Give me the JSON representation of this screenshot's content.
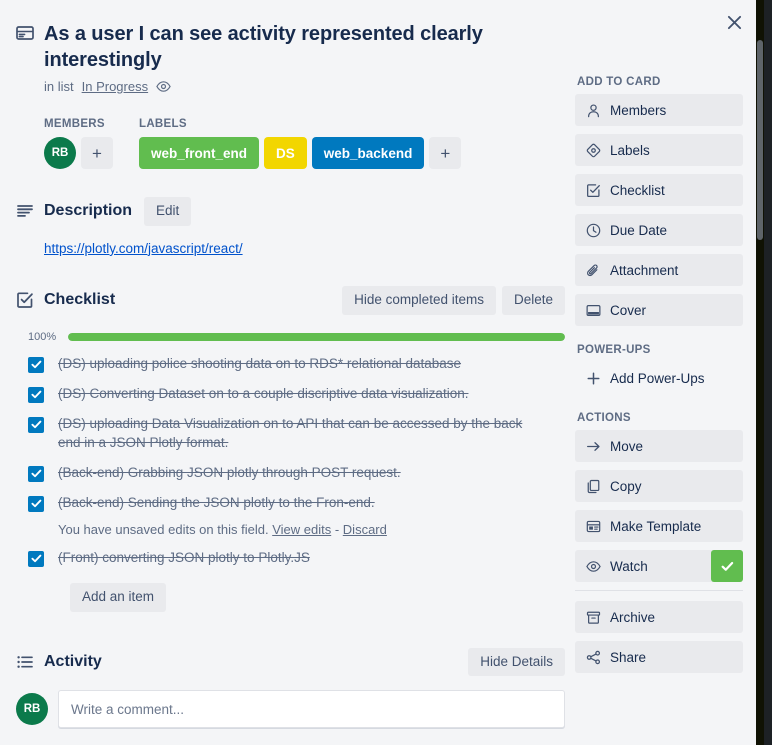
{
  "window": {
    "close_label": "×"
  },
  "card": {
    "icon": "card-window-icon",
    "title": "As a user I can see activity represented clearly interestingly",
    "in_list_prefix": "in list",
    "list_name": "In Progress",
    "watching_icon": "eye-icon"
  },
  "members": {
    "heading": "MEMBERS",
    "avatars": [
      {
        "initials": "RB",
        "color": "#0b7a4b"
      }
    ],
    "add_label": "+"
  },
  "labels": {
    "heading": "LABELS",
    "chips": [
      {
        "text": "web_front_end",
        "color": "#61bd4f"
      },
      {
        "text": "DS",
        "color": "#f2d600"
      },
      {
        "text": "web_backend",
        "color": "#0079bf"
      }
    ],
    "add_label": "+"
  },
  "description": {
    "icon": "description-lines-icon",
    "heading": "Description",
    "edit_label": "Edit",
    "link_text": "https://plotly.com/javascript/react/"
  },
  "checklist": {
    "icon": "checklist-icon",
    "heading": "Checklist",
    "hide_completed_label": "Hide completed items",
    "delete_label": "Delete",
    "progress_percent_label": "100%",
    "progress_percent": 100,
    "progress_color": "#61bd4f",
    "checkbox_color": "#0079bf",
    "items": [
      {
        "text": "(DS) uploading police shooting data on to RDS* relational database",
        "checked": true
      },
      {
        "text": "(DS) Converting Dataset on to a couple discriptive data visualization.",
        "checked": true
      },
      {
        "text": "(DS) uploading Data Visualization on to API that can be accessed by the back end in a JSON Plotly format.",
        "checked": true
      },
      {
        "text": "(Back-end) Grabbing JSON plotly through POST request.",
        "checked": true
      },
      {
        "text": "(Back-end) Sending the JSON plotly to the Fron-end.",
        "checked": true
      },
      {
        "text": "(Front) converting JSON plotly to Plotly.JS",
        "checked": true
      }
    ],
    "unsaved": {
      "message": "You have unsaved edits on this field.",
      "view_edits_label": "View edits",
      "separator": "-",
      "discard_label": "Discard"
    },
    "add_item_label": "Add an item"
  },
  "activity": {
    "icon": "activity-list-icon",
    "heading": "Activity",
    "hide_details_label": "Hide Details",
    "avatar_initials": "RB",
    "comment_placeholder": "Write a comment..."
  },
  "sidebar": {
    "add_to_card": {
      "title": "ADD TO CARD",
      "items": [
        {
          "label": "Members",
          "icon": "person-icon"
        },
        {
          "label": "Labels",
          "icon": "label-tag-icon"
        },
        {
          "label": "Checklist",
          "icon": "checklist-icon"
        },
        {
          "label": "Due Date",
          "icon": "clock-icon"
        },
        {
          "label": "Attachment",
          "icon": "paperclip-icon"
        },
        {
          "label": "Cover",
          "icon": "cover-icon"
        }
      ]
    },
    "power_ups": {
      "title": "POWER-UPS",
      "items": [
        {
          "label": "Add Power-Ups",
          "icon": "plus-icon"
        }
      ]
    },
    "actions": {
      "title": "ACTIONS",
      "items": [
        {
          "label": "Move",
          "icon": "arrow-right-icon",
          "badge": null
        },
        {
          "label": "Copy",
          "icon": "copy-icon",
          "badge": null
        },
        {
          "label": "Make Template",
          "icon": "template-icon",
          "badge": null
        },
        {
          "label": "Watch",
          "icon": "eye-icon",
          "badge": "check"
        },
        {
          "label": "Archive",
          "icon": "archive-icon",
          "badge": null
        },
        {
          "label": "Share",
          "icon": "share-icon",
          "badge": null
        }
      ],
      "watch_badge_color": "#61bd4f"
    }
  }
}
